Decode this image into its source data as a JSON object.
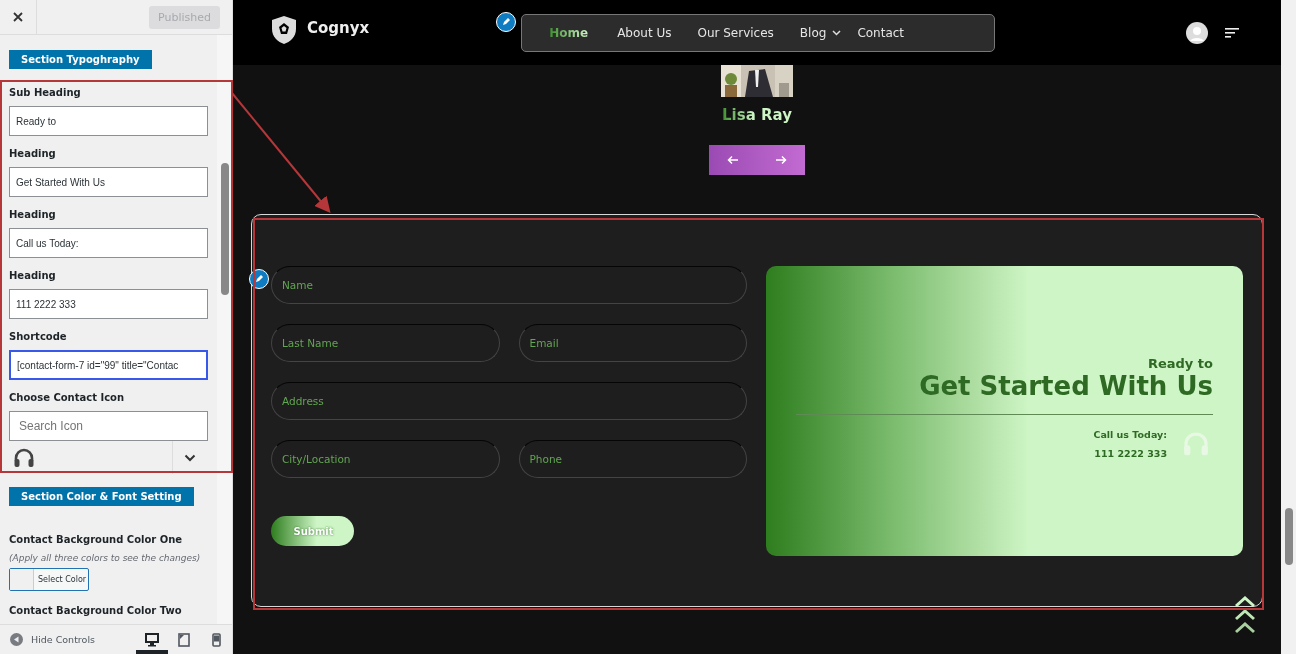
{
  "sidebar": {
    "publish_button": "Published",
    "controls": [
      {
        "kind": "section",
        "label": "Section Typoghraphy"
      },
      {
        "kind": "text",
        "label": "Sub Heading",
        "value": "Ready to",
        "focused": false
      },
      {
        "kind": "text",
        "label": "Heading",
        "value": "Get Started With Us",
        "focused": false
      },
      {
        "kind": "text",
        "label": "Heading",
        "value": "Call us Today:",
        "focused": false
      },
      {
        "kind": "text",
        "label": "Heading",
        "value": "111 2222 333",
        "focused": false
      },
      {
        "kind": "text",
        "label": "Shortcode",
        "value": "[contact-form-7 id=\"99\" title=\"Contac",
        "focused": true
      },
      {
        "kind": "icon_picker",
        "label": "Choose Contact Icon",
        "placeholder": "Search Icon"
      },
      {
        "kind": "section",
        "label": "Section Color & Font Setting"
      },
      {
        "kind": "color",
        "label": "Contact Background Color One",
        "note": "(Apply all three colors to see the changes)",
        "button": "Select Color"
      },
      {
        "kind": "label",
        "label": "Contact Background Color Two"
      }
    ],
    "footer": {
      "hide_controls": "Hide Controls",
      "devices": [
        {
          "kind": "desktop",
          "selected": true
        },
        {
          "kind": "tablet",
          "selected": false
        },
        {
          "kind": "mobile",
          "selected": false
        }
      ]
    }
  },
  "site": {
    "logo": "Cognyx",
    "nav": [
      {
        "label": "Home",
        "selected": true,
        "dropdown": false
      },
      {
        "label": "About Us",
        "selected": false,
        "dropdown": false
      },
      {
        "label": "Our Services",
        "selected": false,
        "dropdown": false
      },
      {
        "label": "Blog",
        "selected": false,
        "dropdown": true
      },
      {
        "label": "Contact",
        "selected": false,
        "dropdown": false
      }
    ],
    "testimonial": {
      "name": "Lisa Ray"
    },
    "contact": {
      "rows": [
        [
          {
            "placeholder": "Name"
          }
        ],
        [
          {
            "placeholder": "Last Name"
          },
          {
            "placeholder": "Email"
          }
        ],
        [
          {
            "placeholder": "Address"
          }
        ],
        [
          {
            "placeholder": "City/Location"
          },
          {
            "placeholder": "Phone"
          }
        ]
      ],
      "submit": "Submit",
      "panel": {
        "subheading": "Ready to",
        "heading": "Get Started With Us",
        "call_label": "Call us Today:",
        "phone": "111 2222 333"
      }
    }
  }
}
